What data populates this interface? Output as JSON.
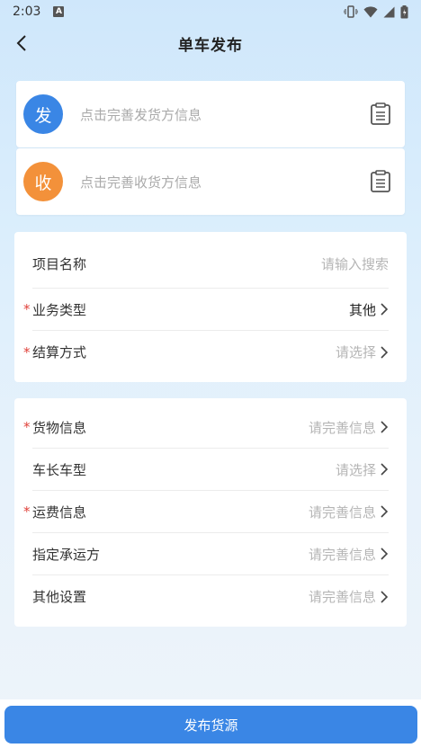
{
  "status_bar": {
    "time": "2:03",
    "notification_letter": "A"
  },
  "nav": {
    "title": "单车发布",
    "back_icon": "chevron-left-icon"
  },
  "sender": {
    "badge": "发",
    "placeholder": "点击完善发货方信息",
    "badge_color": "#3a86e5",
    "icon": "clipboard-icon"
  },
  "receiver": {
    "badge": "收",
    "placeholder": "点击完善收货方信息",
    "badge_color": "#f3913a",
    "icon": "clipboard-icon"
  },
  "section1": {
    "project_name": {
      "label": "项目名称",
      "placeholder": "请输入搜索"
    },
    "business_type": {
      "label": "业务类型",
      "value": "其他",
      "required_mark": "*"
    },
    "settlement": {
      "label": "结算方式",
      "value": "请选择",
      "required_mark": "*"
    }
  },
  "section2": {
    "cargo": {
      "label": "货物信息",
      "value": "请完善信息",
      "required_mark": "*"
    },
    "vehicle": {
      "label": "车长车型",
      "value": "请选择"
    },
    "freight": {
      "label": "运费信息",
      "value": "请完善信息",
      "required_mark": "*"
    },
    "carrier": {
      "label": "指定承运方",
      "value": "请完善信息"
    },
    "other": {
      "label": "其他设置",
      "value": "请完善信息"
    }
  },
  "publish_button": {
    "label": "发布货源",
    "color": "#3a86e5"
  }
}
